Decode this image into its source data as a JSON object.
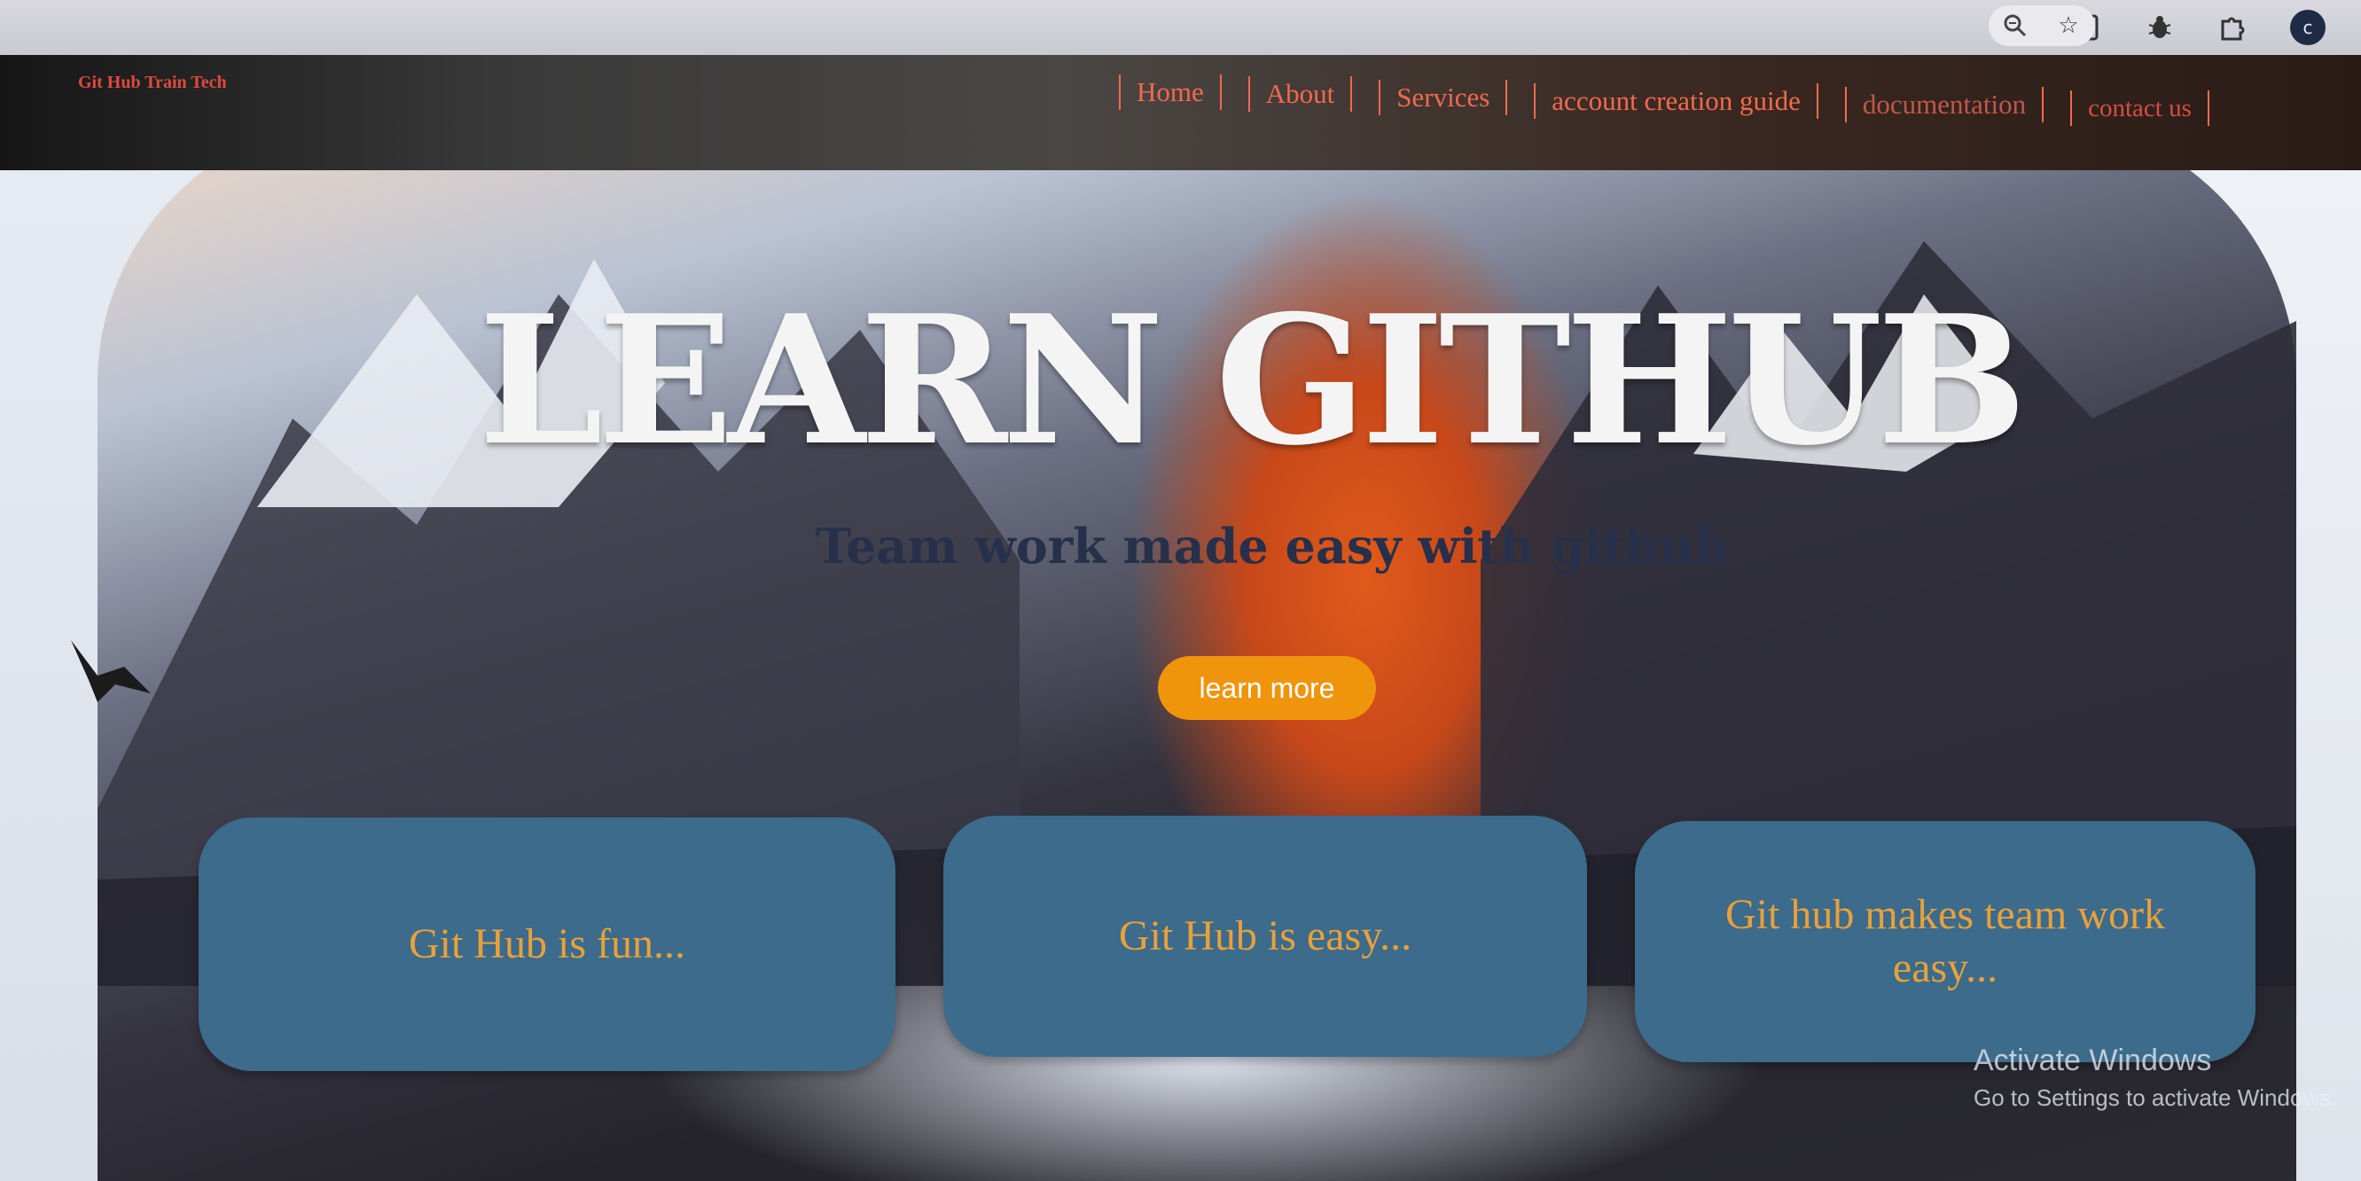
{
  "browser": {
    "zoom_icon": "zoom-icon",
    "star_icon": "star-icon",
    "sidepanel_icon": "side-panel-icon",
    "extensions_icon": "bug-icon",
    "puzzle_icon": "puzzle-icon",
    "profile_initial": "c"
  },
  "header": {
    "brand": "Git Hub Train Tech",
    "nav": [
      {
        "label": "Home"
      },
      {
        "label": "About"
      },
      {
        "label": "Services"
      },
      {
        "label": "account creation guide"
      },
      {
        "label": "documentation"
      },
      {
        "label": "contact us"
      }
    ]
  },
  "hero": {
    "title": "LEARN GITHUB",
    "subtitle": "Team work made easy with github",
    "button_label": "learn more"
  },
  "cards": [
    {
      "text": "Git Hub is fun..."
    },
    {
      "text": "Git Hub is easy..."
    },
    {
      "text": "Git hub makes team work easy..."
    }
  ],
  "watermark": {
    "title": "Activate Windows",
    "subtitle": "Go to Settings to activate Windows."
  },
  "colors": {
    "brand": "#e0493e",
    "nav": "#f26a4f",
    "button": "#f0940c",
    "card_bg": "#3c6b8c",
    "card_text": "#e8a13a"
  }
}
